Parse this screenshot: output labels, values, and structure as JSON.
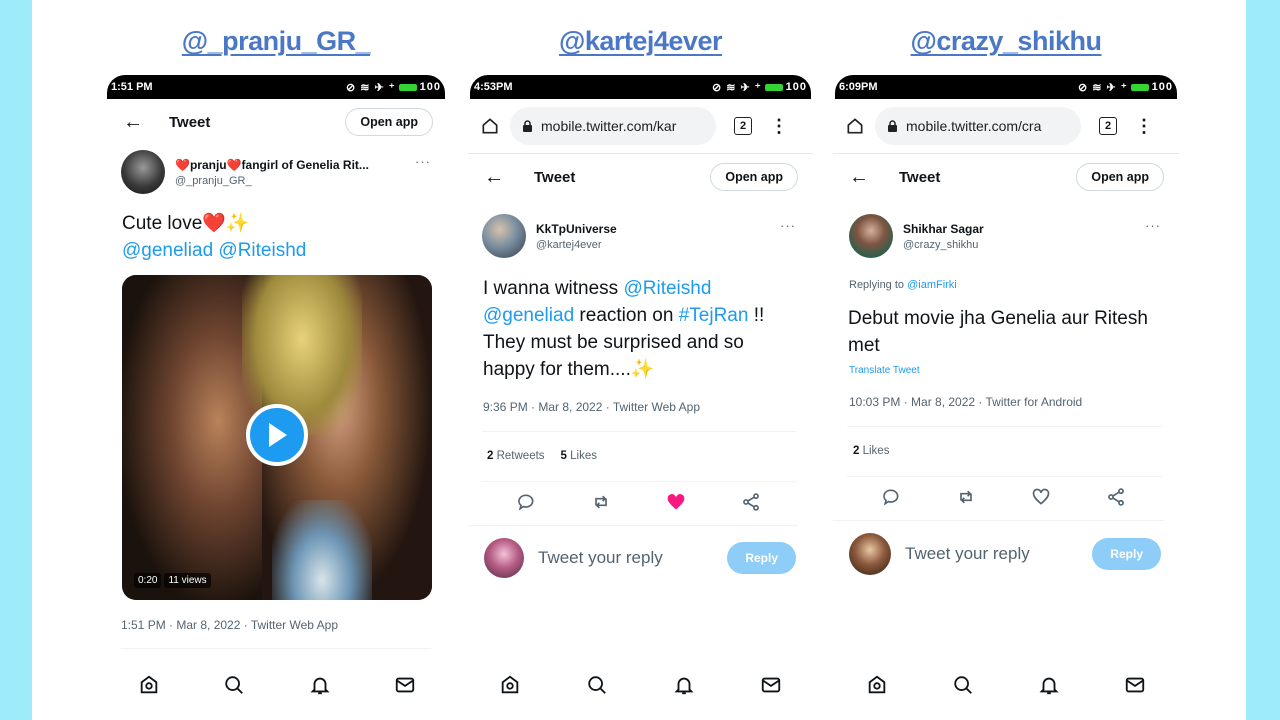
{
  "colors": {
    "page_bg": "#9eebfb",
    "handle": "#4a78c6",
    "link": "#1d9bf0",
    "like": "#f91880",
    "reply_btn": "#8ecdf8"
  },
  "panels": [
    {
      "handle": "@_pranju_GR_",
      "status_time": "1:51 PM",
      "status_icons": "⊘ ≋ ✈ ⁺",
      "battery": "100",
      "header_title": "Tweet",
      "open_app": "Open app",
      "author_name": "❤️pranju❤️fangirl of Genelia Rit...",
      "author_handle": "@_pranju_GR_",
      "more": "···",
      "text_plain": "Cute love❤️✨",
      "mentions": "@geneliad @Riteishd",
      "video_time": "0:20",
      "video_views": "11 views",
      "meta": "1:51 PM · Mar 8, 2022 · Twitter Web App"
    },
    {
      "handle": "@kartej4ever",
      "status_time": "4:53PM",
      "status_icons": "⊘ ≋ ✈ ⁺",
      "battery": "100",
      "url": "mobile.twitter.com/kar",
      "tabs": "2",
      "header_title": "Tweet",
      "open_app": "Open app",
      "author_name": "KkTpUniverse",
      "author_handle": "@kartej4ever",
      "more": "···",
      "text_1": "I wanna witness ",
      "mention_1": "@Riteishd",
      "mention_2": "@geneliad",
      "text_2": " reaction on ",
      "hashtag": "#TejRan",
      "text_3": " !! They must be surprised and so happy for them....✨",
      "meta": "9:36 PM · Mar 8, 2022 · Twitter Web App",
      "retweets_count": "2",
      "retweets_label": "Retweets",
      "likes_count": "5",
      "likes_label": "Likes",
      "reply_placeholder": "Tweet your reply",
      "reply_button": "Reply"
    },
    {
      "handle": "@crazy_shikhu",
      "status_time": "6:09PM",
      "status_icons": "⊘ ≋ ✈ ⁺",
      "battery": "100",
      "url": "mobile.twitter.com/cra",
      "tabs": "2",
      "header_title": "Tweet",
      "open_app": "Open app",
      "author_name": "Shikhar Sagar",
      "author_handle": "@crazy_shikhu",
      "more": "···",
      "replying_prefix": "Replying to ",
      "replying_to": "@iamFirki",
      "text": "Debut movie jha Genelia aur Ritesh met",
      "translate": "Translate Tweet",
      "meta": "10:03 PM · Mar 8, 2022 · Twitter for Android",
      "likes_count": "2",
      "likes_label": "Likes",
      "reply_placeholder": "Tweet your reply",
      "reply_button": "Reply"
    }
  ]
}
